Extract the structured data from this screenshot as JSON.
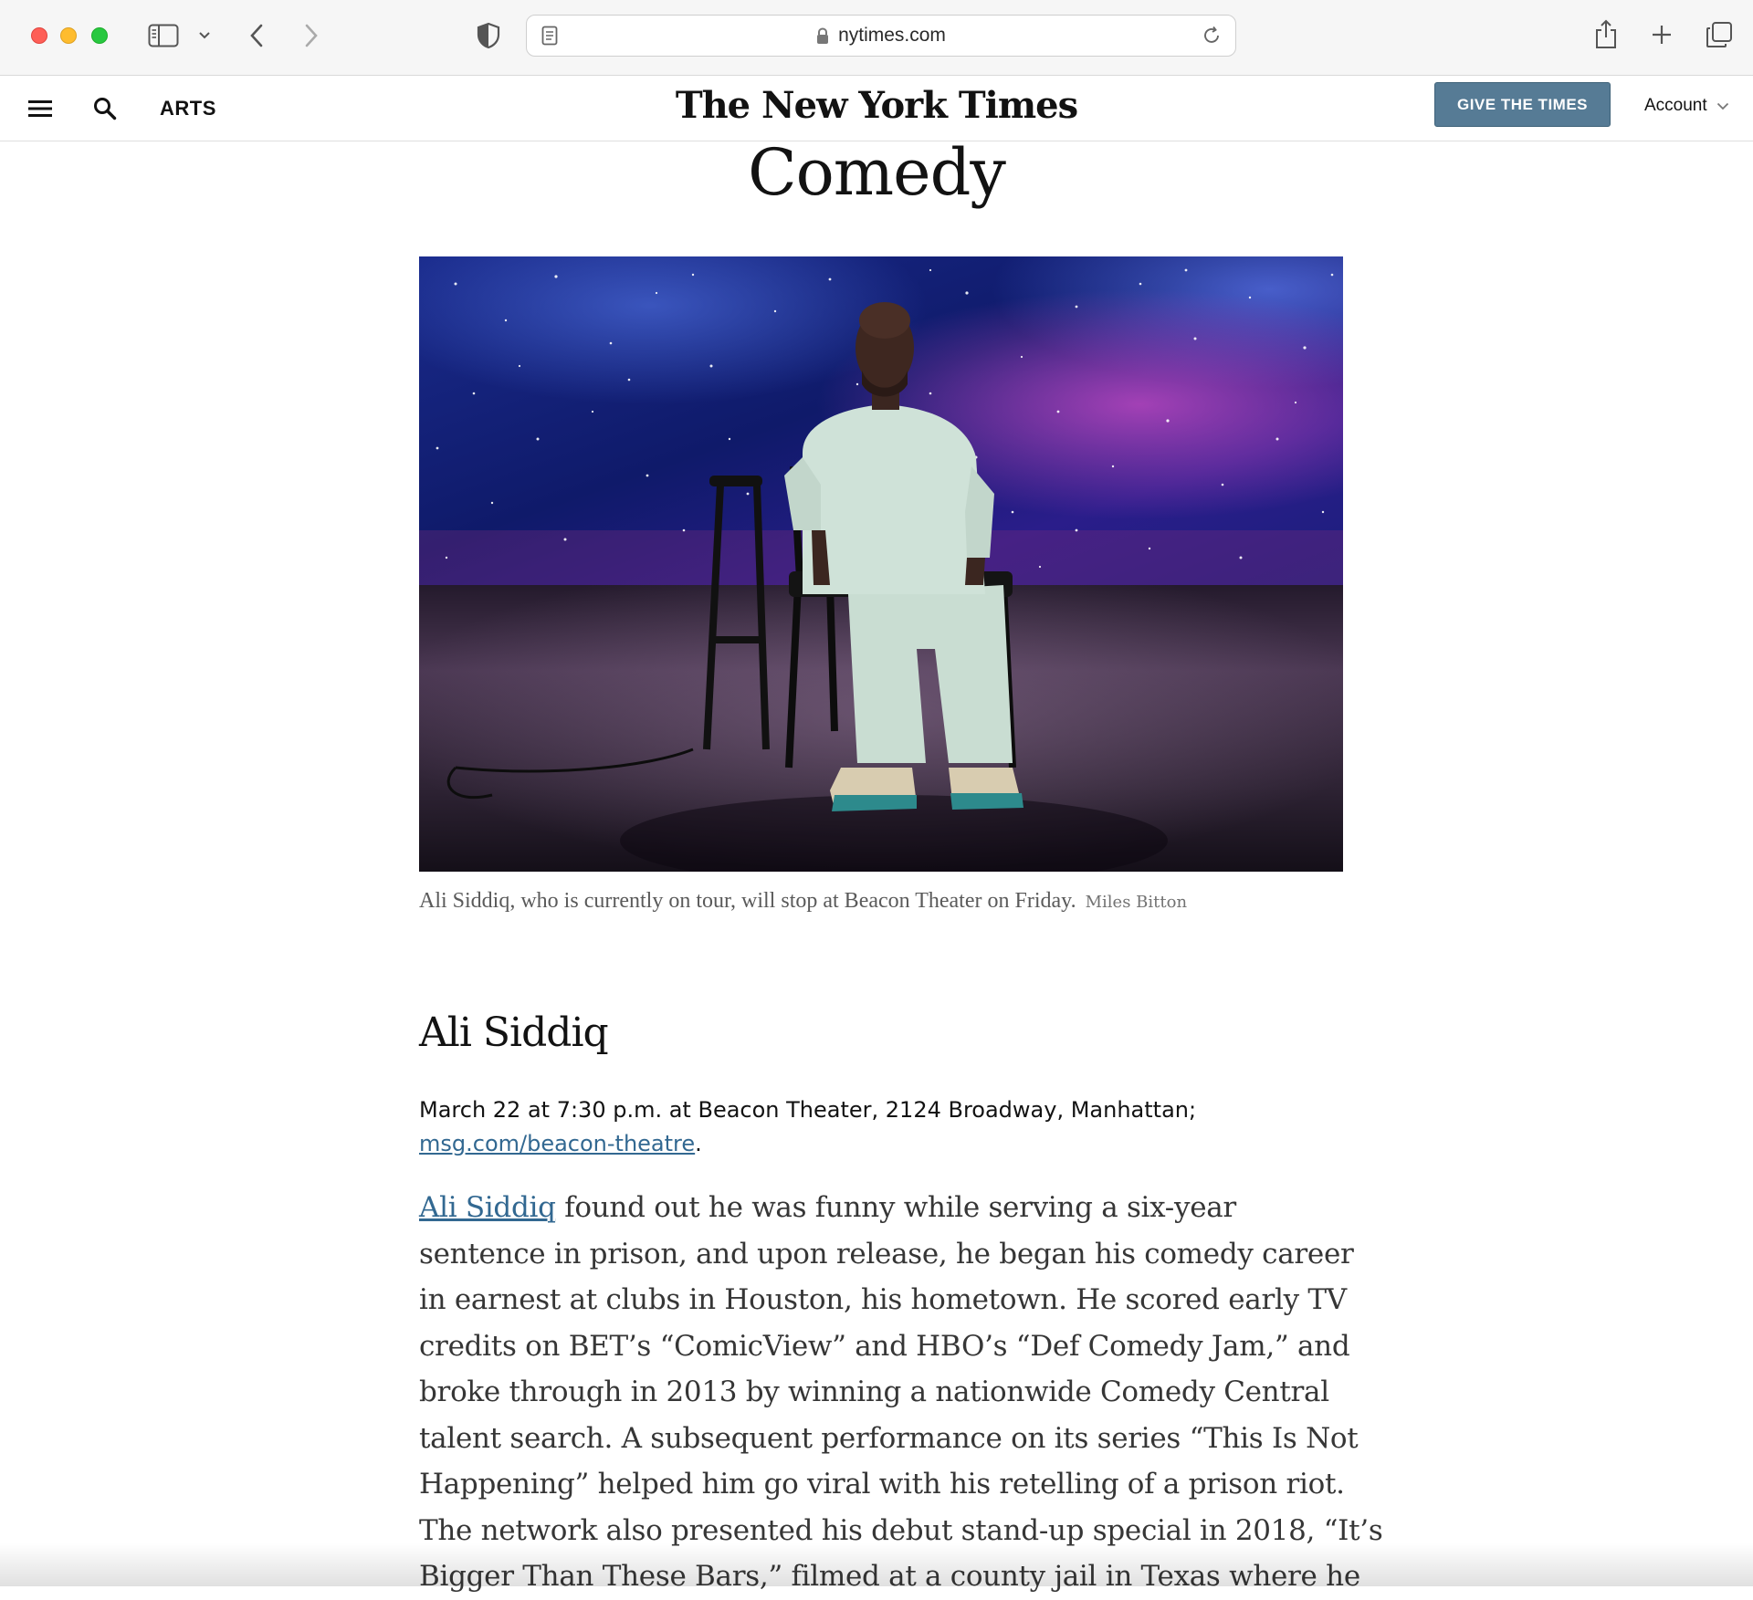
{
  "browser": {
    "url": "nytimes.com",
    "icons": [
      "sidebar-toggle-icon",
      "chevron-down-icon",
      "back-arrow-icon",
      "forward-arrow-icon",
      "privacy-shield-icon",
      "reader-view-icon",
      "lock-icon",
      "reload-icon",
      "share-icon",
      "new-tab-icon",
      "tab-overview-icon"
    ]
  },
  "header": {
    "section": "ARTS",
    "masthead": "The New York Times",
    "give_button": "GIVE THE TIMES",
    "account": "Account"
  },
  "article": {
    "section_title": "Comedy",
    "image_caption": "Ali Siddiq, who is currently on tour, will stop at Beacon Theater on Friday.",
    "image_credit": "Miles Bitton",
    "listing_title": "Ali Siddiq",
    "details_text": "March 22 at 7:30 p.m. at Beacon Theater, 2124 Broadway, Manhattan;",
    "details_link": "msg.com/beacon-theatre",
    "details_suffix": ".",
    "body_link": "Ali Siddiq",
    "body_line_1_rest": " found out he was funny while serving a six-year",
    "body_lines": [
      "sentence in prison, and upon release, he began his comedy career",
      "in earnest at clubs in Houston, his hometown. He scored early TV",
      "credits on BET’s “ComicView” and HBO’s “Def Comedy Jam,” and",
      "broke through in 2013 by winning a nationwide Comedy Central",
      "talent search. A subsequent performance on its series “This Is Not",
      "Happening” helped him go viral with his retelling of a prison riot.",
      "The network also presented his debut stand-up special in 2018, “It’s",
      "Bigger Than These Bars,” filmed at a county jail in Texas where he"
    ]
  },
  "colors": {
    "give_button_bg": "#567b95",
    "link": "#326891",
    "text": "#121212"
  }
}
